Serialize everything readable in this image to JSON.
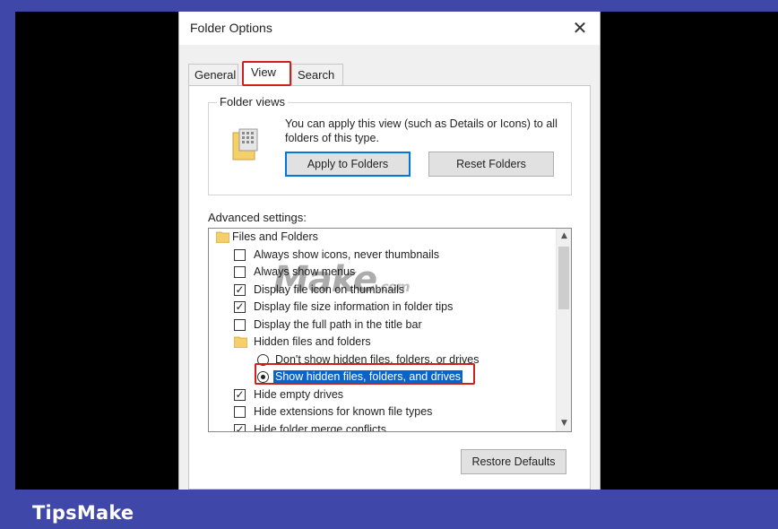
{
  "footer": {
    "brand": "TipsMake"
  },
  "dialog": {
    "title": "Folder Options",
    "close_glyph": "✕",
    "tabs": [
      {
        "label": "General"
      },
      {
        "label": "View"
      },
      {
        "label": "Search"
      }
    ],
    "active_tab": "View",
    "folder_views": {
      "legend": "Folder views",
      "description": "You can apply this view (such as Details or Icons) to all folders of this type.",
      "apply_button": "Apply to Folders",
      "reset_button": "Reset Folders"
    },
    "advanced": {
      "label": "Advanced settings:",
      "watermark": "Make",
      "watermark_suffix": ".com",
      "items": [
        {
          "type": "folder",
          "label": "Files and Folders"
        },
        {
          "type": "checkbox",
          "checked": false,
          "label": "Always show icons, never thumbnails"
        },
        {
          "type": "checkbox",
          "checked": false,
          "label": "Always show menus"
        },
        {
          "type": "checkbox",
          "checked": true,
          "label": "Display file icon on thumbnails"
        },
        {
          "type": "checkbox",
          "checked": true,
          "label": "Display file size information in folder tips"
        },
        {
          "type": "checkbox",
          "checked": false,
          "label": "Display the full path in the title bar"
        },
        {
          "type": "folder",
          "label": "Hidden files and folders"
        },
        {
          "type": "radio",
          "checked": false,
          "label": "Don't show hidden files, folders, or drives"
        },
        {
          "type": "radio",
          "checked": true,
          "label": "Show hidden files, folders, and drives"
        },
        {
          "type": "checkbox",
          "checked": true,
          "label": "Hide empty drives"
        },
        {
          "type": "checkbox",
          "checked": false,
          "label": "Hide extensions for known file types"
        },
        {
          "type": "checkbox",
          "checked": true,
          "label": "Hide folder merge conflicts"
        }
      ],
      "scroll_up_glyph": "▲",
      "scroll_down_glyph": "▼",
      "check_glyph": "✓"
    },
    "restore_button": "Restore Defaults"
  },
  "colors": {
    "frame": "#3f48a8",
    "highlight_outline": "#d0201c",
    "selection": "#0a64c8",
    "folder_icon": "#f5cf6a"
  }
}
